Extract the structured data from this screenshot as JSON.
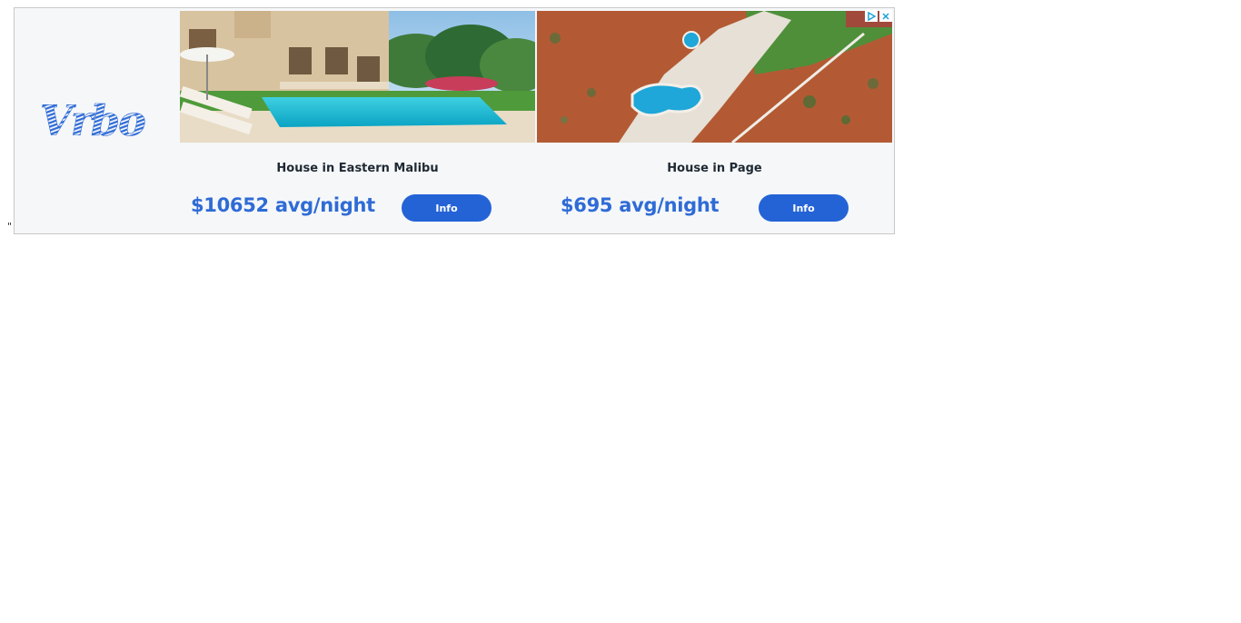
{
  "page": {
    "stray_text": "\""
  },
  "ad": {
    "brand": "Vrbo",
    "brand_color": "#2f6bd6",
    "button_color": "#2463d6",
    "adchoices_icon": "adchoices-triangle-icon",
    "close_icon": "close-x-icon",
    "listings": [
      {
        "title": "House in Eastern Malibu",
        "price": "$10652 avg/night",
        "button_label": "Info",
        "image": "luxury-villa-pool-photo"
      },
      {
        "title": "House in Page",
        "price": "$695 avg/night",
        "button_label": "Info",
        "image": "aerial-desert-pool-photo"
      }
    ]
  }
}
